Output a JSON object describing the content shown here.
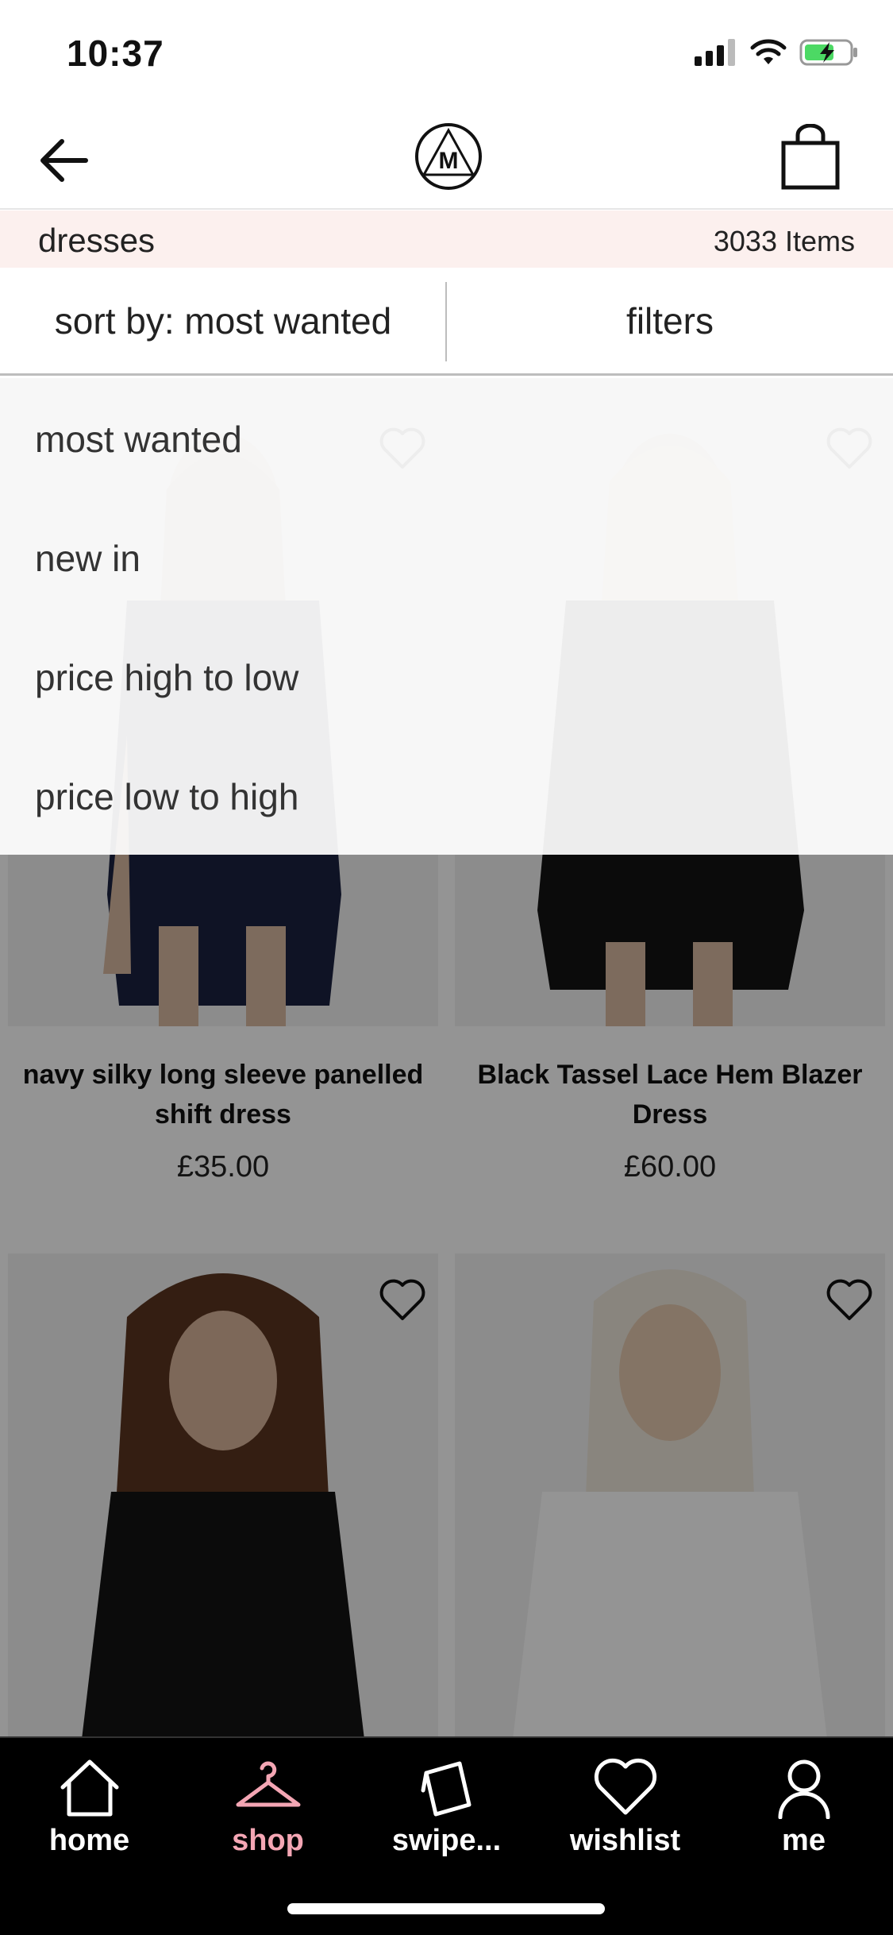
{
  "status_bar": {
    "time": "10:37"
  },
  "header": {
    "logo_letter": "M"
  },
  "category": {
    "name": "dresses",
    "count": "3033 Items"
  },
  "toolbar": {
    "sort_label": "sort by: most wanted",
    "filters_label": "filters"
  },
  "sort_options": [
    "most wanted",
    "new in",
    "price high to low",
    "price low to high"
  ],
  "products": [
    {
      "title": "navy silky long sleeve panelled shift dress",
      "price": "£35.00"
    },
    {
      "title": "Black Tassel Lace Hem Blazer Dress",
      "price": "£60.00"
    }
  ],
  "tabs": [
    {
      "label": "home",
      "icon": "home-icon"
    },
    {
      "label": "shop",
      "icon": "hanger-icon",
      "active": true
    },
    {
      "label": "swipe...",
      "icon": "cards-icon"
    },
    {
      "label": "wishlist",
      "icon": "heart-icon"
    },
    {
      "label": "me",
      "icon": "user-icon"
    }
  ],
  "colors": {
    "accent_pink": "#f4a6b4",
    "category_bg": "#fcf0ee",
    "tab_bar_bg": "#000000"
  }
}
